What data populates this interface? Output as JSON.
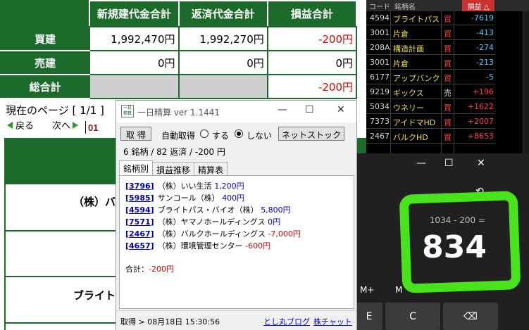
{
  "summary": {
    "headers": [
      "新規建代金合計",
      "返済代金合計",
      "損益合計"
    ],
    "rows": [
      {
        "label": "買建",
        "new": "1,992,470円",
        "close": "1,992,270円",
        "pl": "-200円"
      },
      {
        "label": "売建",
        "new": "0円",
        "close": "0円",
        "pl": "0円"
      },
      {
        "label": "総合計",
        "new": "",
        "close": "",
        "pl": "-200円"
      }
    ]
  },
  "page_nav": {
    "label": "現在のページ [ 1/1 ]",
    "back": "戻る",
    "next": "次へ",
    "page_value": "01"
  },
  "background_rows": {
    "row1": "（株）バ",
    "row2": "（",
    "row3": "ブライト"
  },
  "stocklist": {
    "headers": {
      "code": "コード",
      "name": "銘柄名",
      "pl": "損益 △"
    },
    "rows": [
      {
        "code": "4594",
        "name": "ブライトパス",
        "side": "買",
        "pl": "-7619"
      },
      {
        "code": "3001",
        "name": "片倉",
        "side": "買",
        "pl": "-413"
      },
      {
        "code": "208A",
        "name": "構造計画",
        "side": "買",
        "pl": "-274"
      },
      {
        "code": "3001",
        "name": "片倉",
        "side": "買",
        "pl": "-213"
      },
      {
        "code": "6177",
        "name": "アップバンク",
        "side": "買",
        "pl": "-5"
      },
      {
        "code": "9219",
        "name": "ギックス",
        "side": "売",
        "pl": "+196"
      },
      {
        "code": "5034",
        "name": "ウネリー",
        "side": "買",
        "pl": "+1622"
      },
      {
        "code": "7373",
        "name": "アイドマHD",
        "side": "買",
        "pl": "+2007"
      },
      {
        "code": "2467",
        "name": "バルクHD",
        "side": "買",
        "pl": "+8653"
      }
    ]
  },
  "calculator": {
    "expression": "1034 - 200 =",
    "result": "834",
    "history_icon": "history-icon",
    "window_controls": {
      "minimize": "—",
      "maximize": "☐",
      "close": "✕"
    },
    "memory": {
      "m_plus": "M+",
      "m_minus": "M"
    },
    "keys": {
      "e": "E",
      "c": "C",
      "backspace": "⌫"
    }
  },
  "popup": {
    "title": "一日精算 ver 1.1441",
    "logo_text": "一日精算",
    "get_button": "取 得",
    "auto_get_label": "自動取得",
    "radio_on": "する",
    "radio_off": "しない",
    "netstock_button": "ネットストック",
    "summary_line": "6 銘柄 / 82 返済 / -200 円",
    "tabs": [
      "銘柄別",
      "損益推移",
      "精算表"
    ],
    "items": [
      {
        "code": "3796",
        "name": "（株）いい生活",
        "pl": "1,200円"
      },
      {
        "code": "5985",
        "name": "サンコール（株）",
        "pl": "400円"
      },
      {
        "code": "4594",
        "name": "ブライトパス・バイオ（株）",
        "pl": "5,800円"
      },
      {
        "code": "7571",
        "name": "（株）ヤマノホールディングス",
        "pl": "0円"
      },
      {
        "code": "2467",
        "name": "（株）バルクホールディングス",
        "pl": "-7,000円"
      },
      {
        "code": "4657",
        "name": "（株）環境管理センター",
        "pl": "-600円"
      }
    ],
    "total_label": "合計：",
    "total_value": "-200円",
    "status_time": "取得 > 08月18日 15:30:56",
    "blog_link": "とし丸ブログ",
    "chart_link": "株チャット",
    "window_controls": {
      "minimize": "—",
      "maximize": "☐",
      "close": "✕"
    }
  },
  "colors": {
    "header_green": "#1c6b2a",
    "negative_red": "#e00000",
    "highlight_green": "#49e31b"
  }
}
